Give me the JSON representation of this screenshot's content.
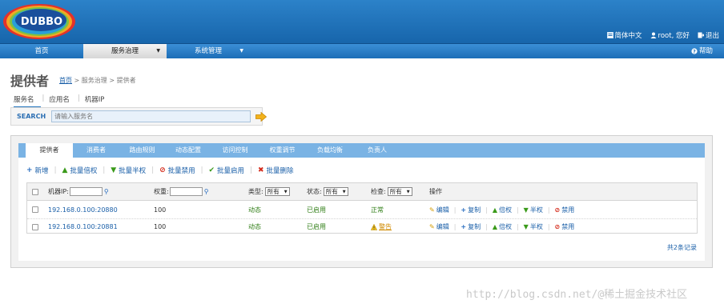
{
  "header": {
    "logo_text": "DUBBO",
    "links": [
      {
        "label": "简体中文",
        "icon": "language-icon"
      },
      {
        "label": "root, 您好",
        "icon": "user-icon"
      },
      {
        "label": "退出",
        "icon": "logout-icon"
      }
    ]
  },
  "nav": {
    "items": [
      {
        "label": "首页"
      },
      {
        "label": "服务治理",
        "dropdown_marker": "▼"
      },
      {
        "label": "系统管理",
        "dropdown_marker": "▼"
      }
    ],
    "help": "帮助"
  },
  "page": {
    "title": "提供者",
    "breadcrumb": {
      "home": "首页",
      "rest": "> 服务治理 > 提供者"
    }
  },
  "search": {
    "tabs": [
      "服务名",
      "应用名",
      "机器IP"
    ],
    "label": "SEARCH",
    "placeholder": "请输入服务名"
  },
  "tabs": [
    "提供者",
    "消费者",
    "路由规则",
    "动态配置",
    "访问控制",
    "权重调节",
    "负载均衡",
    "负责人"
  ],
  "actions": [
    {
      "label": "新增",
      "icon": "+",
      "color": "#2a6ec0"
    },
    {
      "label": "批量倍权",
      "icon": "▲",
      "color": "#3a9a1a"
    },
    {
      "label": "批量半权",
      "icon": "▼",
      "color": "#3a9a1a"
    },
    {
      "label": "批量禁用",
      "icon": "⊘",
      "color": "#d42a1a"
    },
    {
      "label": "批量启用",
      "icon": "✔",
      "color": "#3a9a1a"
    },
    {
      "label": "批量删除",
      "icon": "✖",
      "color": "#d42a1a"
    }
  ],
  "grid": {
    "header": {
      "ip_label": "机器IP:",
      "weight_label": "权重:",
      "type_label": "类型:",
      "type_value": "所有",
      "status_label": "状态:",
      "status_value": "所有",
      "check_label": "检查:",
      "check_value": "所有",
      "ops_label": "操作"
    },
    "rows": [
      {
        "address": "192.168.0.100:20880",
        "weight": "100",
        "type": "动态",
        "status": "已启用",
        "check": "正常"
      },
      {
        "address": "192.168.0.100:20881",
        "weight": "100",
        "type": "动态",
        "status": "已启用",
        "check": "警告"
      }
    ],
    "ops": [
      {
        "label": "编辑",
        "icon": "✎",
        "color": "#d29a00"
      },
      {
        "label": "复制",
        "icon": "+",
        "color": "#2a6ec0"
      },
      {
        "label": "倍权",
        "icon": "▲",
        "color": "#3a9a1a"
      },
      {
        "label": "半权",
        "icon": "▼",
        "color": "#3a9a1a"
      },
      {
        "label": "禁用",
        "icon": "⊘",
        "color": "#d42a1a"
      }
    ]
  },
  "record_count": "共2条记录",
  "watermark": "http://blog.csdn.net/@稀土掘金技术社区"
}
